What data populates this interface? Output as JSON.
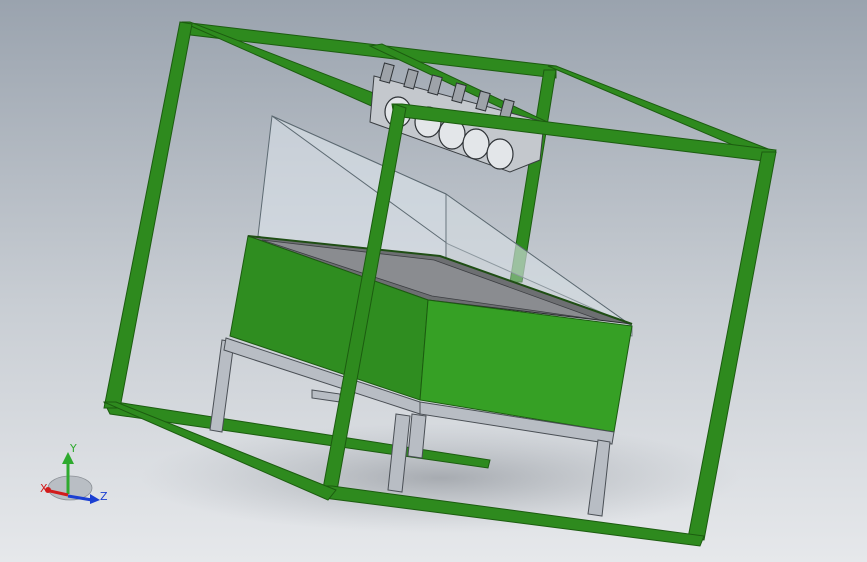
{
  "colors": {
    "frame": "#2e8a1e",
    "frame_dark": "#1c5c10",
    "tank": "#2f8d20",
    "tank_dark": "#236b17",
    "stand": "#b8bdc4",
    "glass": "#dfe6ec",
    "axis_x": "#d21b1b",
    "axis_y": "#2eaa2e",
    "axis_z": "#1b3fd2"
  },
  "triad": {
    "x_label": "X",
    "y_label": "Y",
    "z_label": "Z"
  },
  "icons": [
    "coordinate-triad-icon"
  ]
}
